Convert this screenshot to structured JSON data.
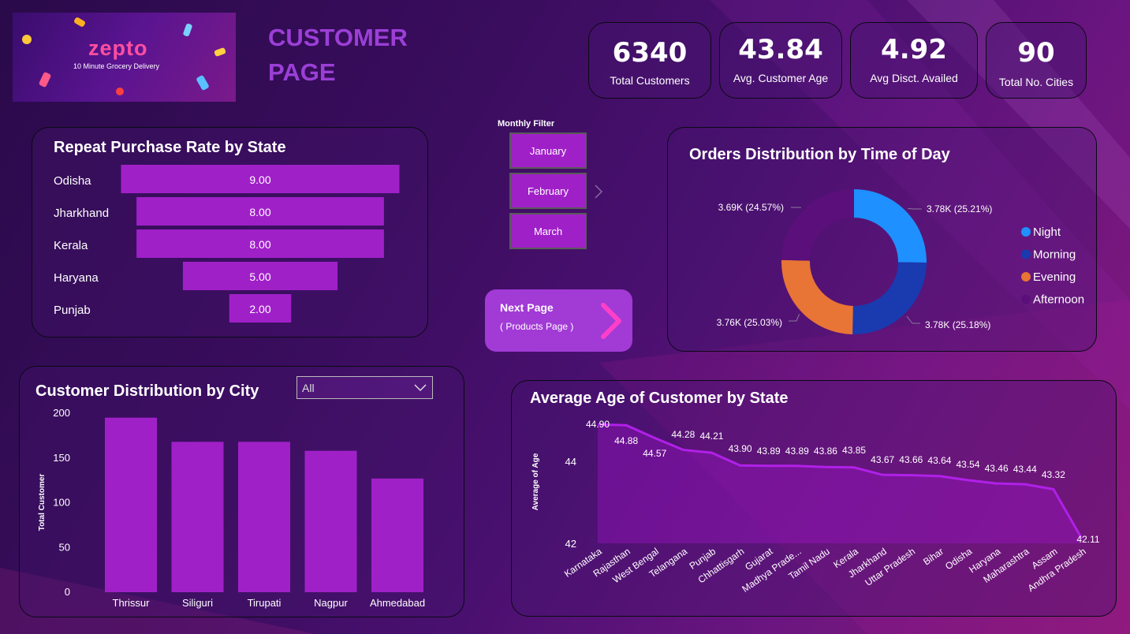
{
  "header": {
    "logo_brand": "zepto",
    "logo_tagline": "10 Minute Grocery Delivery",
    "title_line1": "CUSTOMER",
    "title_line2": "PAGE"
  },
  "kpis": [
    {
      "value": "6340",
      "label": "Total Customers"
    },
    {
      "value": "43.84",
      "label": "Avg. Customer Age"
    },
    {
      "value": "4.92",
      "label": "Avg Disct. Availed"
    },
    {
      "value": "90",
      "label": "Total No. Cities"
    }
  ],
  "monthly_filter": {
    "label": "Monthly Filter",
    "options": [
      "January",
      "February",
      "March"
    ]
  },
  "next_page": {
    "title": "Next Page",
    "subtitle": "( Products Page )"
  },
  "city_filter": {
    "selected": "All"
  },
  "colors": {
    "accent": "#a020c8",
    "title_purple": "#9b3fd6",
    "night": "#1e90ff",
    "morning": "#1a3ab0",
    "evening": "#e87436",
    "afternoon": "#5a0f7a",
    "next_arrow": "#ff3fc8"
  },
  "chart_data": [
    {
      "id": "repeat",
      "type": "bar",
      "title": "Repeat Purchase Rate by State",
      "categories": [
        "Odisha",
        "Jharkhand",
        "Kerala",
        "Haryana",
        "Punjab"
      ],
      "values": [
        9.0,
        8.0,
        8.0,
        5.0,
        2.0
      ],
      "labels": [
        "9.00",
        "8.00",
        "8.00",
        "5.00",
        "2.00"
      ],
      "orientation": "horizontal-funnel"
    },
    {
      "id": "orders",
      "type": "pie",
      "title": "Orders Distribution by Time of Day",
      "slices": [
        {
          "name": "Night",
          "value": 3780,
          "label": "3.78K (25.21%)"
        },
        {
          "name": "Morning",
          "value": 3775,
          "label": "3.78K (25.18%)"
        },
        {
          "name": "Evening",
          "value": 3763,
          "label": "3.76K (25.03%)"
        },
        {
          "name": "Afternoon",
          "value": 3694,
          "label": "3.69K (24.57%)"
        }
      ],
      "legend": "right"
    },
    {
      "id": "city",
      "type": "bar",
      "title": "Customer Distribution by City",
      "ylabel": "Total Customer",
      "categories": [
        "Thrissur",
        "Siliguri",
        "Tirupati",
        "Nagpur",
        "Ahmedabad"
      ],
      "values": [
        195,
        168,
        168,
        158,
        127
      ],
      "ylim": [
        0,
        200
      ],
      "yticks": [
        "0",
        "50",
        "100",
        "150",
        "200"
      ]
    },
    {
      "id": "age",
      "type": "area",
      "title": "Average Age of Customer by State",
      "ylabel": "Average of Age",
      "categories": [
        "Karnataka",
        "Rajasthan",
        "West Bengal",
        "Telangana",
        "Punjab",
        "Chhattisgarh",
        "Gujarat",
        "Madhya Prade...",
        "Tamil Nadu",
        "Kerala",
        "Jharkhand",
        "Uttar Pradesh",
        "Bihar",
        "Odisha",
        "Haryana",
        "Maharashtra",
        "Assam",
        "Andhra Pradesh"
      ],
      "values": [
        44.9,
        44.88,
        44.57,
        44.28,
        44.21,
        43.9,
        43.89,
        43.89,
        43.86,
        43.85,
        43.67,
        43.66,
        43.64,
        43.54,
        43.46,
        43.44,
        43.32,
        42.11
      ],
      "labels": [
        "44.90",
        "44.88",
        "44.57",
        "44.28",
        "44.21",
        "43.90",
        "43.89",
        "43.89",
        "43.86",
        "43.85",
        "43.67",
        "43.66",
        "43.64",
        "43.54",
        "43.46",
        "43.44",
        "43.32",
        "42.11"
      ],
      "ylim": [
        42,
        45
      ],
      "yticks": [
        "42",
        "44"
      ]
    }
  ]
}
